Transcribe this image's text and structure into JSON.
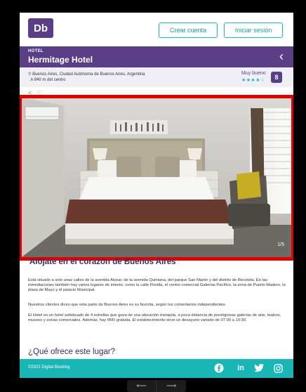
{
  "header": {
    "logo_text": "Db",
    "create_account": "Crear cuenta",
    "login": "Iniciar sesión"
  },
  "hotel": {
    "kicker": "HOTEL",
    "name": "Hermitage Hotel",
    "address_line1": "Buenos Aires, Ciudad Autónoma de Buenos Aires, Argentina",
    "address_line2": "A 940 m del centro",
    "rating_label": "Muy bueno",
    "stars": "★★★★☆",
    "score": "8"
  },
  "gallery": {
    "counter": "1/5"
  },
  "content": {
    "section_title": "Alójate en el corazón de Buenos Aires",
    "para1": "Está situado a solo unas calles de la avenida Alvear, de la avenida Quintana, del parque San Martín y del distrito de Recoleta. En las inmediaciones también hay varios lugares de interés, como la calle Florida, el centro comercial Galerías Pacífico, la zona de Puerto Madero, la plaza de Mayo y el palacio Municipal.",
    "para2": "Nuestros clientes dicen que esta parte de Buenos Aires es su favorita, según los comentarios independientes.",
    "para3": "El Hotel es un hotel sofisticado de 4 estrellas que goza de una ubicación tranquila, a poca distancia de prestigiosas galerías de arte, teatros, museos y zonas comerciales. Además, hay WiFi gratuita. El establecimiento sirve un desayuno variado de 07:00 a 10:30.",
    "offer_title": "¿Qué ofrece este lugar?"
  },
  "footer": {
    "copyright": "©2021 Digital Booking",
    "social": [
      "facebook-icon",
      "linkedin-icon",
      "twitter-icon",
      "instagram-icon"
    ]
  },
  "colors": {
    "primary": "#5b3f86",
    "accent": "#1ab6b6",
    "highlight": "#e00000"
  }
}
